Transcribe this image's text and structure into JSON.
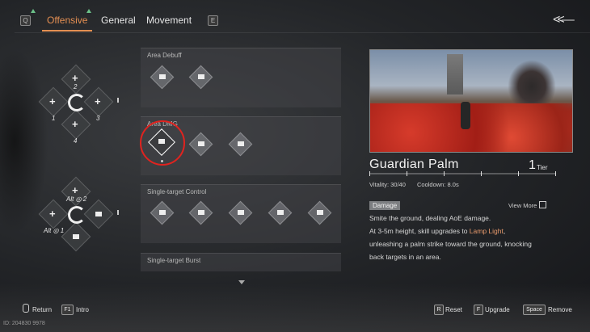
{
  "topbar": {
    "left_key": "Q",
    "right_key": "E",
    "tabs": [
      {
        "label": "Offensive",
        "active": true
      },
      {
        "label": "General",
        "active": false
      },
      {
        "label": "Movement",
        "active": false
      }
    ]
  },
  "loadout": {
    "upper": {
      "top": "2",
      "left": "1",
      "right": "3",
      "bottom": "4"
    },
    "lower": {
      "top": "Alt",
      "top_num": "2",
      "bottom": "Alt",
      "bottom_num": "1"
    }
  },
  "categories": [
    {
      "title": "Area Debuff",
      "count": 2
    },
    {
      "title": "Area DMG",
      "count": 3,
      "selected_index": 0
    },
    {
      "title": "Single-target Control",
      "count": 5
    },
    {
      "title": "Single-target Burst",
      "count": 0
    }
  ],
  "detail": {
    "name": "Guardian Palm",
    "tier_number": "1",
    "tier_label": "Tier",
    "vitality": "Vitality: 30/40",
    "cooldown": "Cooldown: 8.0s",
    "badge": "Damage",
    "view_more": "View More",
    "line1": "Smite the ground, dealing AoE damage.",
    "line2_a": "At 3-5m height, skill upgrades to ",
    "line2_hl": "Lamp Light",
    "line2_b": ",",
    "line3": "unleashing a palm strike toward the ground, knocking",
    "line4": "back targets in an area."
  },
  "footer": {
    "return_label": "Return",
    "intro_key": "F1",
    "intro_label": "Intro",
    "reset_key": "R",
    "reset_label": "Reset",
    "upgrade_key": "F",
    "upgrade_label": "Upgrade",
    "remove_key": "Space",
    "remove_label": "Remove",
    "uid": "ID: 204830 9978"
  },
  "colors": {
    "accent": "#e48f52",
    "highlight": "#e89a6c",
    "selection_ring": "#e0231f"
  }
}
